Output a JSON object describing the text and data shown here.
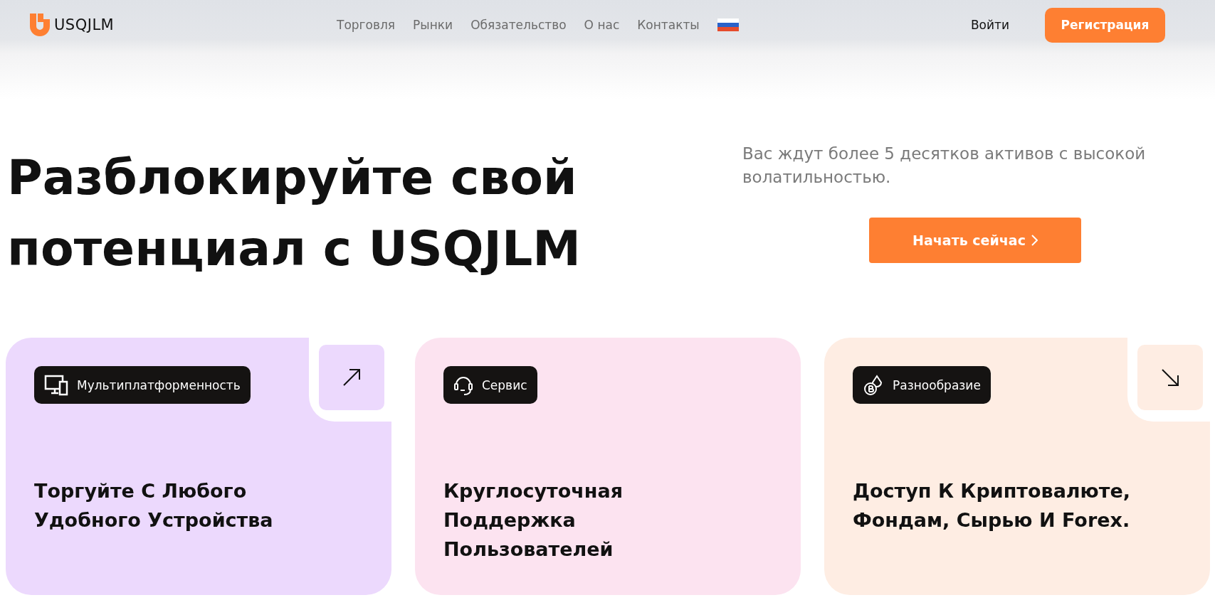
{
  "header": {
    "logo": "USQJLM",
    "nav": [
      "Торговля",
      "Рынки",
      "Обязательство",
      "О нас",
      "Контакты"
    ],
    "login": "Войти",
    "register": "Регистрация"
  },
  "hero": {
    "title": "Разблокируйте свой потенциал с USQJLM",
    "subtitle": "Вас ждут более 5 десятков активов с высокой волатильностью.",
    "cta": "Начать сейчас"
  },
  "cards": [
    {
      "kind": "linked",
      "badge": "Мультиплатформенность",
      "heading": "Торгуйте С Любого Удобного Устройства",
      "color": "#ecd9fd"
    },
    {
      "kind": "plain",
      "badge": "Сервис",
      "heading": "Круглосуточная Поддержка Пользователей",
      "color": "#fce3f0"
    },
    {
      "kind": "linked",
      "badge": "Разнообразие",
      "heading": "Доступ К Криптовалюте, Фондам, Сырью И Forex.",
      "color": "#feede3"
    }
  ]
}
